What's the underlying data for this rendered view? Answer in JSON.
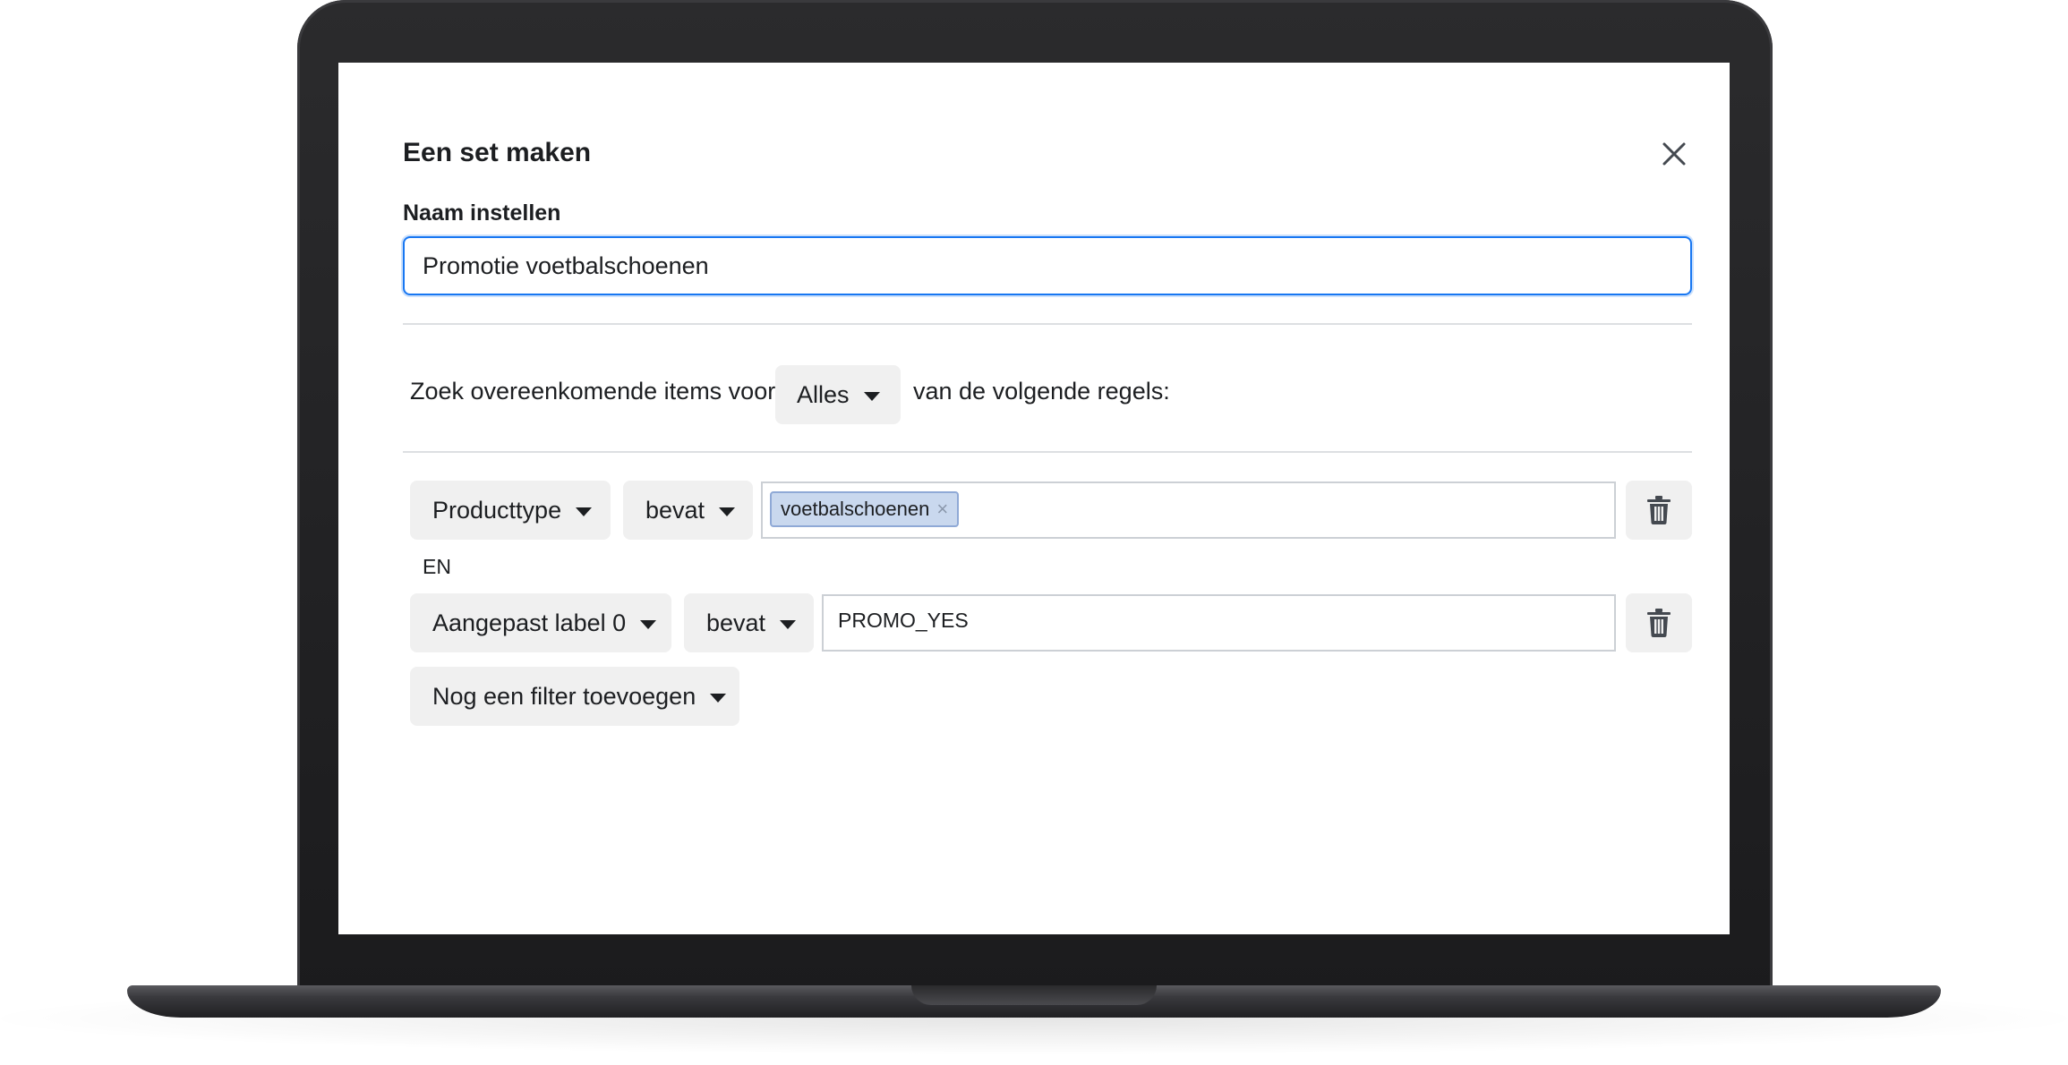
{
  "dialog": {
    "title": "Een set maken",
    "close_icon": "close-icon"
  },
  "name_field": {
    "label": "Naam instellen",
    "value": "Promotie voetbalschoenen"
  },
  "match_rule": {
    "prefix": "Zoek overeenkomende items voor",
    "selector": "Alles",
    "suffix": "van de volgende regels:"
  },
  "filters": [
    {
      "field": "Producttype",
      "operator": "bevat",
      "tokens": [
        "voetbalschoenen"
      ]
    },
    {
      "field": "Aangepast label 0",
      "operator": "bevat",
      "value": "PROMO_YES"
    }
  ],
  "conjunction": "EN",
  "add_filter_label": "Nog een filter toevoegen",
  "icons": {
    "remove_token": "×",
    "delete": "trash-icon",
    "dropdown": "caret-down-icon"
  },
  "colors": {
    "focus": "#1877f2",
    "button_bg": "#f0f0f0",
    "token_bg": "#c9d8ee",
    "laptop_frame": "#1b1b1d"
  }
}
